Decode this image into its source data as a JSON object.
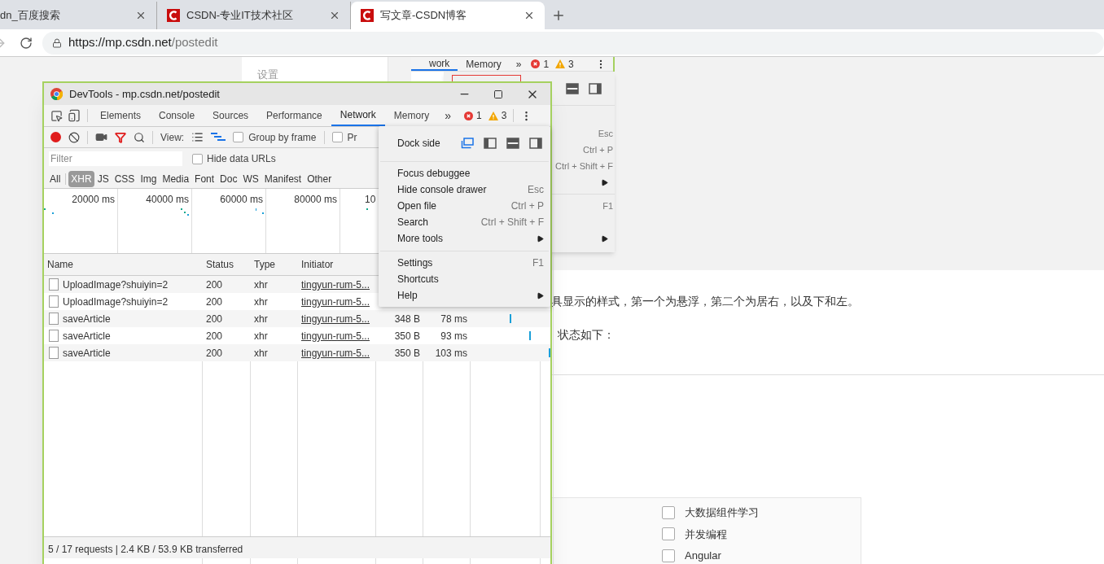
{
  "browser": {
    "tabs": [
      {
        "title": "dn_百度搜索",
        "selected": false,
        "favicon": false
      },
      {
        "title": "CSDN-专业IT技术社区",
        "selected": false,
        "favicon": true
      },
      {
        "title": "写文章-CSDN博客",
        "selected": true,
        "favicon": true
      }
    ],
    "url_host": "https://mp.csdn.net",
    "url_path": "/postedit"
  },
  "page": {
    "settings_label": "设置",
    "article_lines": [
      "具显示的样式，第一个为悬浮，第二个为居右，以及下和左。",
      "状态如下："
    ],
    "categories": [
      {
        "label": "大数据组件学习",
        "checked": false
      },
      {
        "label": "并发编程",
        "checked": false
      },
      {
        "label": "Angular",
        "checked": false
      }
    ]
  },
  "back_devtools": {
    "tabs": [
      {
        "label": "work",
        "selected": true
      },
      {
        "label": "Memory",
        "selected": false
      }
    ],
    "more": "»",
    "errors": "1",
    "warnings": "3",
    "menu_rows": [
      {
        "kind": "shortcut",
        "shortcut": "Esc"
      },
      {
        "kind": "shortcut",
        "shortcut": "Ctrl + P"
      },
      {
        "kind": "shortcut",
        "shortcut": "Ctrl + Shift + F"
      },
      {
        "kind": "submenu"
      },
      {
        "kind": "separator"
      },
      {
        "kind": "shortcut",
        "shortcut": "F1"
      },
      {
        "kind": "blank"
      },
      {
        "kind": "submenu"
      }
    ]
  },
  "devtools": {
    "title": "DevTools - mp.csdn.net/postedit",
    "tabs": [
      {
        "label": "Elements",
        "selected": false
      },
      {
        "label": "Console",
        "selected": false
      },
      {
        "label": "Sources",
        "selected": false
      },
      {
        "label": "Performance",
        "selected": false
      },
      {
        "label": "Network",
        "selected": true
      },
      {
        "label": "Memory",
        "selected": false
      }
    ],
    "more": "»",
    "errors": "1",
    "warnings": "3",
    "recording": true,
    "view_label": "View:",
    "group_by_frame": {
      "label": "Group by frame",
      "checked": false
    },
    "preserve_log": {
      "label": "Pr",
      "checked": false
    },
    "filter_placeholder": "Filter",
    "hide_data_urls": {
      "label": "Hide data URLs",
      "checked": false
    },
    "types": [
      {
        "label": "All",
        "selected": false
      },
      {
        "label": "XHR",
        "selected": true
      },
      {
        "label": "JS",
        "selected": false
      },
      {
        "label": "CSS",
        "selected": false
      },
      {
        "label": "Img",
        "selected": false
      },
      {
        "label": "Media",
        "selected": false
      },
      {
        "label": "Font",
        "selected": false
      },
      {
        "label": "Doc",
        "selected": false
      },
      {
        "label": "WS",
        "selected": false
      },
      {
        "label": "Manifest",
        "selected": false
      },
      {
        "label": "Other",
        "selected": false
      }
    ],
    "overview_ticks": [
      "20000 ms",
      "40000 ms",
      "60000 ms",
      "80000 ms",
      "10"
    ],
    "columns": [
      "Name",
      "Status",
      "Type",
      "Initiator"
    ],
    "rows": [
      {
        "name": "UploadImage?shuiyin=2",
        "status": "200",
        "type": "xhr",
        "initiator": "tingyun-rum-5..."
      },
      {
        "name": "UploadImage?shuiyin=2",
        "status": "200",
        "type": "xhr",
        "initiator": "tingyun-rum-5..."
      },
      {
        "name": "saveArticle",
        "status": "200",
        "type": "xhr",
        "initiator": "tingyun-rum-5...",
        "size": "348 B",
        "time": "78 ms"
      },
      {
        "name": "saveArticle",
        "status": "200",
        "type": "xhr",
        "initiator": "tingyun-rum-5...",
        "size": "350 B",
        "time": "93 ms"
      },
      {
        "name": "saveArticle",
        "status": "200",
        "type": "xhr",
        "initiator": "tingyun-rum-5...",
        "size": "350 B",
        "time": "103 ms"
      }
    ],
    "status_bar": "5 / 17 requests | 2.4 KB / 53.9 KB transferred"
  },
  "menu": {
    "dock_label": "Dock side",
    "dock_options": [
      {
        "selected": true
      },
      {
        "selected": false
      },
      {
        "selected": false
      },
      {
        "selected": false
      }
    ],
    "items": [
      {
        "kind": "separator"
      },
      {
        "kind": "item",
        "label": "Focus debuggee"
      },
      {
        "kind": "item",
        "label": "Hide console drawer",
        "shortcut": "Esc"
      },
      {
        "kind": "item",
        "label": "Open file",
        "shortcut": "Ctrl + P"
      },
      {
        "kind": "item",
        "label": "Search",
        "shortcut": "Ctrl + Shift + F"
      },
      {
        "kind": "submenu",
        "label": "More tools"
      },
      {
        "kind": "separator"
      },
      {
        "kind": "item",
        "label": "Settings",
        "shortcut": "F1"
      },
      {
        "kind": "item",
        "label": "Shortcuts"
      },
      {
        "kind": "submenu",
        "label": "Help"
      }
    ]
  }
}
